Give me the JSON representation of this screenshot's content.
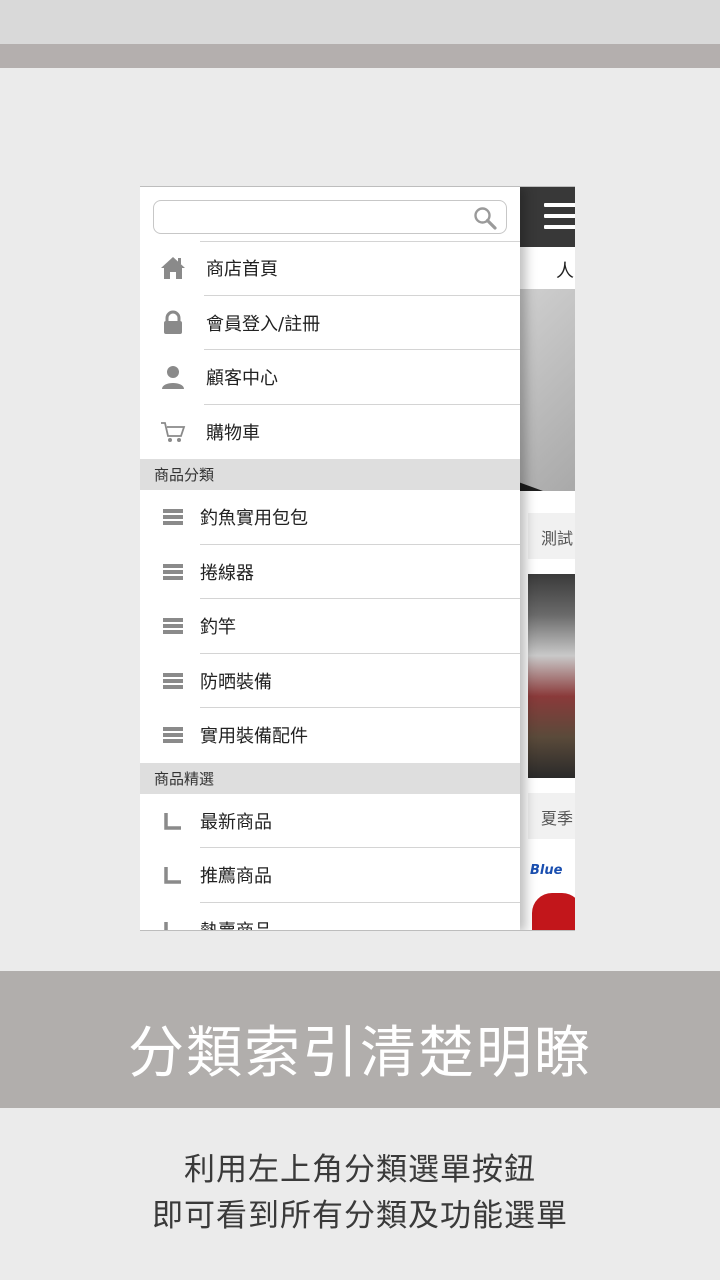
{
  "drawer": {
    "search": {
      "value": "",
      "placeholder": ""
    },
    "main_menu": [
      {
        "label": "商店首頁",
        "icon": "home-icon"
      },
      {
        "label": "會員登入/註冊",
        "icon": "lock-icon"
      },
      {
        "label": "顧客中心",
        "icon": "user-icon"
      },
      {
        "label": "購物車",
        "icon": "cart-icon"
      }
    ],
    "categories_header": "商品分類",
    "categories": [
      {
        "label": "釣魚實用包包",
        "icon": "list-icon"
      },
      {
        "label": "捲線器",
        "icon": "list-icon"
      },
      {
        "label": "釣竿",
        "icon": "list-icon"
      },
      {
        "label": "防晒裝備",
        "icon": "list-icon"
      },
      {
        "label": "實用裝備配件",
        "icon": "list-icon"
      }
    ],
    "featured_header": "商品精選",
    "featured": [
      {
        "label": "最新商品",
        "icon": "corner-icon"
      },
      {
        "label": "推薦商品",
        "icon": "corner-icon"
      },
      {
        "label": "熱賣商品",
        "icon": "corner-icon"
      }
    ]
  },
  "main": {
    "sub_text": "人",
    "section_a": "測試",
    "section_b": "夏季",
    "logo_text": "Blue"
  },
  "caption": {
    "headline": "分類索引清楚明瞭",
    "line1": "利用左上角分類選單按鈕",
    "line2": "即可看到所有分類及功能選單"
  },
  "colors": {
    "background": "#ebebeb",
    "band": "#b1aeac",
    "topbar": "#383838",
    "section_header": "#dedede"
  }
}
